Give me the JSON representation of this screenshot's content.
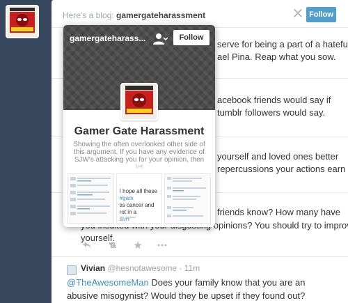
{
  "header": {
    "prefix": "Here's a blog:",
    "blog_name": "gamergateharassment",
    "close_glyph": "✕",
    "follow_label": "Follow"
  },
  "posts": [
    {
      "line1": "serve for being a part of a hateful",
      "line2": "ael Pina. Reap what you sow."
    },
    {
      "line1": "acebook friends would say if",
      "line2": "tumblr followers would say."
    },
    {
      "line1": "yourself and loved ones better",
      "line2": "repercussions your actions earn"
    },
    {
      "line1": "friends know? How many have",
      "line2": "you insulted with your disgusting opinions? You should try to improve",
      "line3": "yourself."
    }
  ],
  "actions_icons": [
    "reply-icon",
    "retweet-icon",
    "favorite-icon",
    "more-icon"
  ],
  "vivian": {
    "name": "Vivian",
    "handle": "@hesnotawesome",
    "time": "· 11m",
    "mention": "@TheAwesomeMan",
    "text": " Does your family know that you are an abusive misogynist? Would they be upset if they found out? Would they kick you out?"
  },
  "popup": {
    "blog_name": "gamergateharass...",
    "follow_label": "Follow",
    "title": "Gamer Gate Harassment",
    "description": "Showing the often overlooked other side of this argument. If you have any evidence of SJW's attacking you for your opinion, then let",
    "thumb_text": {
      "line1_pre": "I hope all these ",
      "line1_hl": "#gam",
      "line2": "ss cancer and rot in a",
      "line3_hl": "suH"
    }
  },
  "colors": {
    "background": "#36465d",
    "accent": "#529ecc",
    "mention": "#3b8fc4"
  }
}
